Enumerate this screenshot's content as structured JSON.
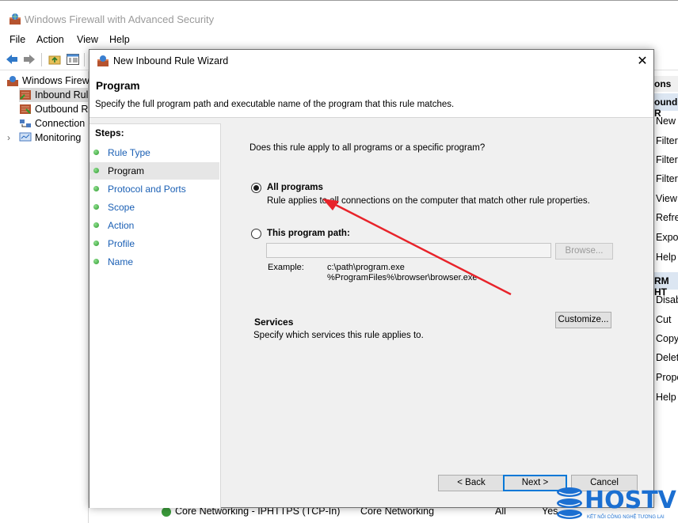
{
  "background": {
    "window_title": "Windows Firewall with Advanced Security",
    "menu": [
      "File",
      "Action",
      "View",
      "Help"
    ],
    "tree": {
      "root": "Windows Firewa",
      "items": [
        "Inbound Rul",
        "Outbound R",
        "Connection",
        "Monitoring"
      ]
    },
    "actions": {
      "header": "ons",
      "sub1": "ound R",
      "items1": [
        "New",
        "Filter",
        "Filter",
        "Filter",
        "View",
        "Refre",
        "Expor",
        "Help"
      ],
      "sub2": "RM HT",
      "items2": [
        "Disab",
        "Cut",
        "Copy",
        "Delet",
        "Prope",
        "Help"
      ]
    },
    "list_rows": [
      {
        "name": "Core Networking - IPHTTPS (TCP-In)",
        "group": "Core Networking",
        "profile": "All",
        "enabled": "Yes"
      }
    ]
  },
  "dialog": {
    "title": "New Inbound Rule Wizard",
    "close_glyph": "✕",
    "heading": "Program",
    "description": "Specify the full program path and executable name of the program that this rule matches.",
    "steps_title": "Steps:",
    "steps": [
      "Rule Type",
      "Program",
      "Protocol and Ports",
      "Scope",
      "Action",
      "Profile",
      "Name"
    ],
    "current_step_index": 1,
    "question": "Does this rule apply to all programs or a specific program?",
    "option_all": {
      "label": "All programs",
      "desc": "Rule applies to all connections on the computer that match other rule properties.",
      "selected": true
    },
    "option_path": {
      "label": "This program path:",
      "value": "",
      "selected": false
    },
    "browse_label": "Browse...",
    "example_label": "Example:",
    "example_lines": [
      "c:\\path\\program.exe",
      "%ProgramFiles%\\browser\\browser.exe"
    ],
    "services_title": "Services",
    "services_desc": "Specify which services this rule applies to.",
    "customize_label": "Customize...",
    "back_label": "< Back",
    "next_label": "Next >",
    "cancel_label": "Cancel"
  },
  "annotation": {
    "arrow_color": "#e8232a"
  },
  "watermark": {
    "brand": "HOSTVN",
    "tagline": "KẾT NỐI CÔNG NGHỆ TƯƠNG LAI",
    "color": "#1b6fd1"
  }
}
